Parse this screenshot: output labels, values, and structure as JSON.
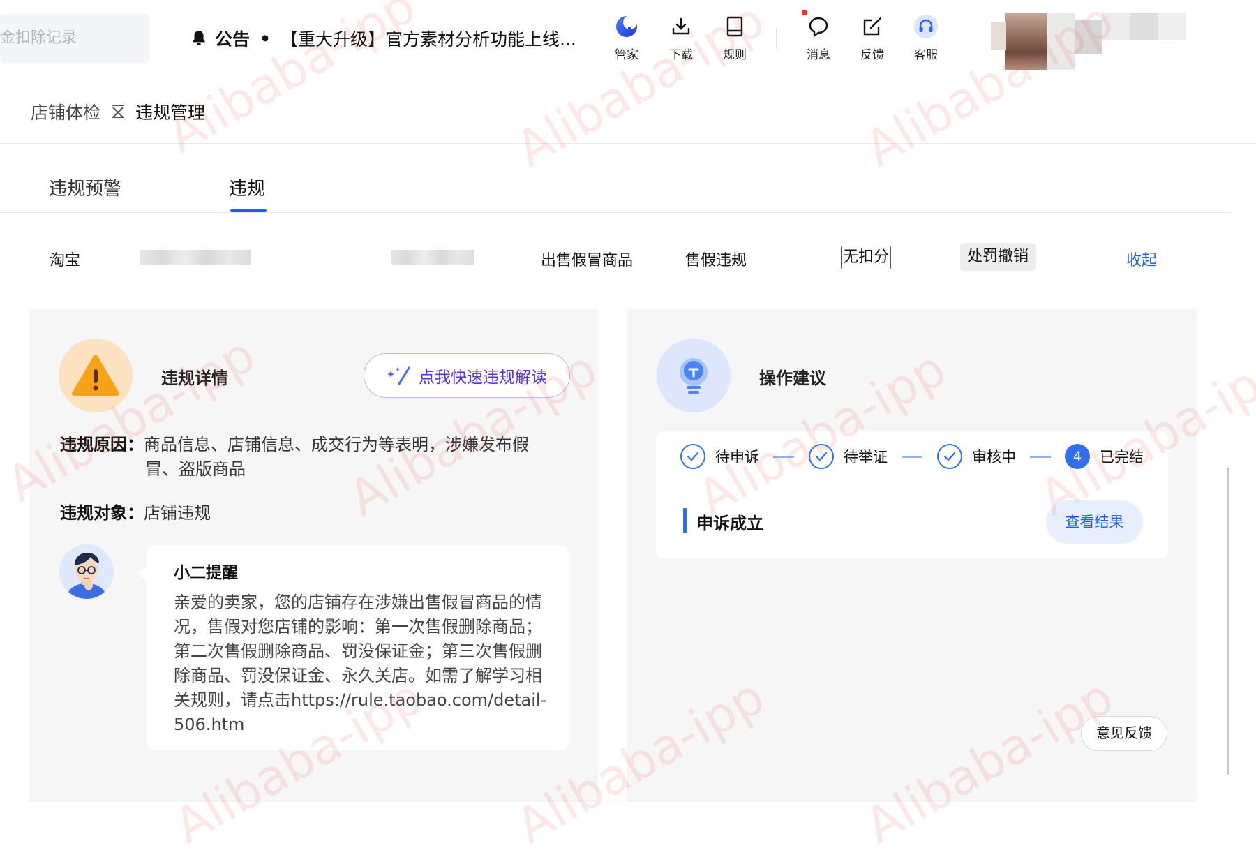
{
  "header": {
    "search_placeholder": "金扣除记录",
    "notice_label": "公告",
    "notice_dot": "•",
    "notice_text": "【重大升级】官方素材分析功能上线...",
    "tools": [
      {
        "label": "管家",
        "icon": "assistant-moon-icon"
      },
      {
        "label": "下载",
        "icon": "download-icon"
      },
      {
        "label": "规则",
        "icon": "book-icon"
      },
      {
        "label": "消息",
        "icon": "message-icon"
      },
      {
        "label": "反馈",
        "icon": "edit-feedback-icon"
      },
      {
        "label": "客服",
        "icon": "headset-icon"
      }
    ]
  },
  "breadcrumb": {
    "first": "店铺体检",
    "current": "违规管理"
  },
  "tabs": [
    {
      "label": "违规预警"
    },
    {
      "label": "违规"
    }
  ],
  "violation_row": {
    "platform": "淘宝",
    "type": "出售假冒商品",
    "category": "售假违规",
    "deduction": "无扣分",
    "status": "处罚撤销",
    "collapse": "收起"
  },
  "details": {
    "title": "违规详情",
    "ai_button": "点我快速违规解读",
    "reason_label": "违规原因：",
    "reason_line1": "商品信息、店铺信息、成交行为等表明，涉嫌发布假",
    "reason_line2": "冒、盗版商品",
    "target_label": "违规对象：",
    "target_value": "店铺违规",
    "reminder_title": "小二提醒",
    "reminder_body": "亲爱的卖家，您的店铺存在涉嫌出售假冒商品的情况，售假对您店铺的影响：第一次售假删除商品；第二次售假删除商品、罚没保证金；第三次售假删除商品、罚没保证金、永久关店。如需了解学习相关规则，请点击https://rule.taobao.com/detail-506.htm"
  },
  "advice": {
    "title": "操作建议",
    "steps": [
      {
        "label": "待申诉"
      },
      {
        "label": "待举证"
      },
      {
        "label": "审核中"
      },
      {
        "label": "已完结",
        "number": "4"
      }
    ],
    "result": "申诉成立",
    "view_button": "查看结果",
    "feedback_button": "意见反馈"
  },
  "watermark": "Alibaba-ipp",
  "colors": {
    "accent": "#1f5fe8",
    "warning": "#f7a21b",
    "ai_purple": "#5a32d8"
  }
}
